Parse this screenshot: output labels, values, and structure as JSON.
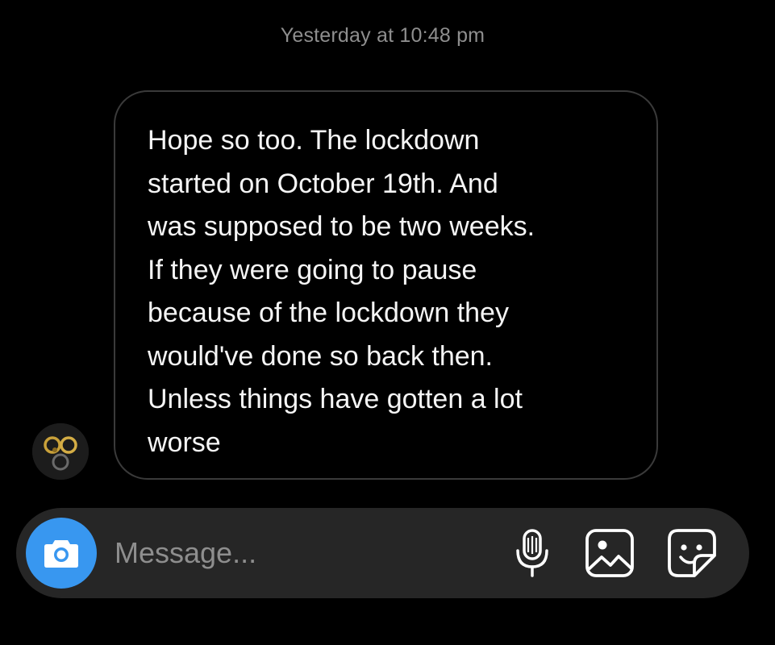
{
  "conversation": {
    "timestamp": "Yesterday at 10:48 pm",
    "message": {
      "text": "Hope so too. The lockdown\nstarted on October 19th. And\nwas supposed to be two weeks.\nIf they were going to pause\nbecause of the lockdown they\nwould've done so back then.\nUnless things have gotten a lot\nworse",
      "sender_avatar_icon": "avatar-olympic-rings"
    }
  },
  "composer": {
    "placeholder": "Message...",
    "value": "",
    "camera_icon": "camera-icon",
    "mic_icon": "microphone-icon",
    "photo_icon": "photo-gallery-icon",
    "sticker_icon": "sticker-icon"
  },
  "colors": {
    "background": "#000000",
    "bubble_border": "#3a3a3a",
    "text": "#f5f5f5",
    "muted_text": "#8e8e8e",
    "composer_background": "#262626",
    "camera_accent": "#3897f0"
  }
}
